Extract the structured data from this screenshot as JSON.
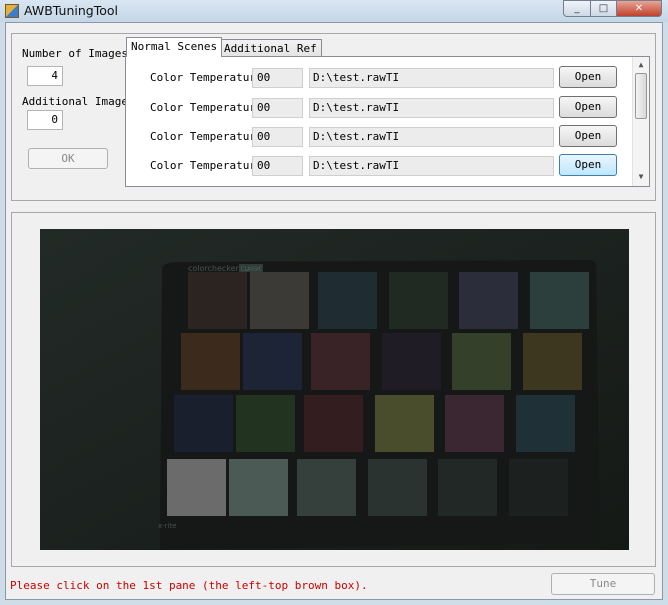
{
  "window": {
    "title": "AWBTuningTool",
    "min_glyph": "_",
    "max_glyph": "□",
    "close_glyph": "✕"
  },
  "left_panel": {
    "number_of_images_label": "Number of Images",
    "number_of_images_value": "4",
    "additional_images_label": "Additional Images :",
    "additional_images_value": "0",
    "ok_label": "OK"
  },
  "tabs": [
    {
      "label": "Normal Scenes",
      "active": true
    },
    {
      "label": "Additional Ref",
      "active": false
    }
  ],
  "rows": [
    {
      "label": "Color Temperature :",
      "temp": "00",
      "path": "D:\\test.rawTI",
      "button": "Open"
    },
    {
      "label": "Color Temperature :",
      "temp": "00",
      "path": "D:\\test.rawTI",
      "button": "Open"
    },
    {
      "label": "Color Temperature :",
      "temp": "00",
      "path": "D:\\test.rawTI",
      "button": "Open"
    },
    {
      "label": "Color Temperature :",
      "temp": "00",
      "path": "D:\\test.rawTI",
      "button": "Open"
    }
  ],
  "scrollbar": {
    "up_glyph": "▲",
    "down_glyph": "▼"
  },
  "image": {
    "brand_text": "colorchecker",
    "brand_badge": "CLASSIC",
    "logo_text": "x-rite",
    "patch_colors": [
      "#2b2420",
      "#3b3a36",
      "#1f2d33",
      "#202a22",
      "#2b2d3a",
      "#2c3f3c",
      "#3c2a1c",
      "#1c2435",
      "#3a2326",
      "#1f1c26",
      "#34402a",
      "#3e3720",
      "#1a1f2e",
      "#22331f",
      "#331d1e",
      "#4a4d2c",
      "#3a2731",
      "#1f3036",
      "#6a6b6a",
      "#4b5a55",
      "#35403c",
      "#2a332f",
      "#222825",
      "#1c211f"
    ]
  },
  "status_text": "Please click on the 1st pane (the left-top brown box).",
  "tune_label": "Tune"
}
